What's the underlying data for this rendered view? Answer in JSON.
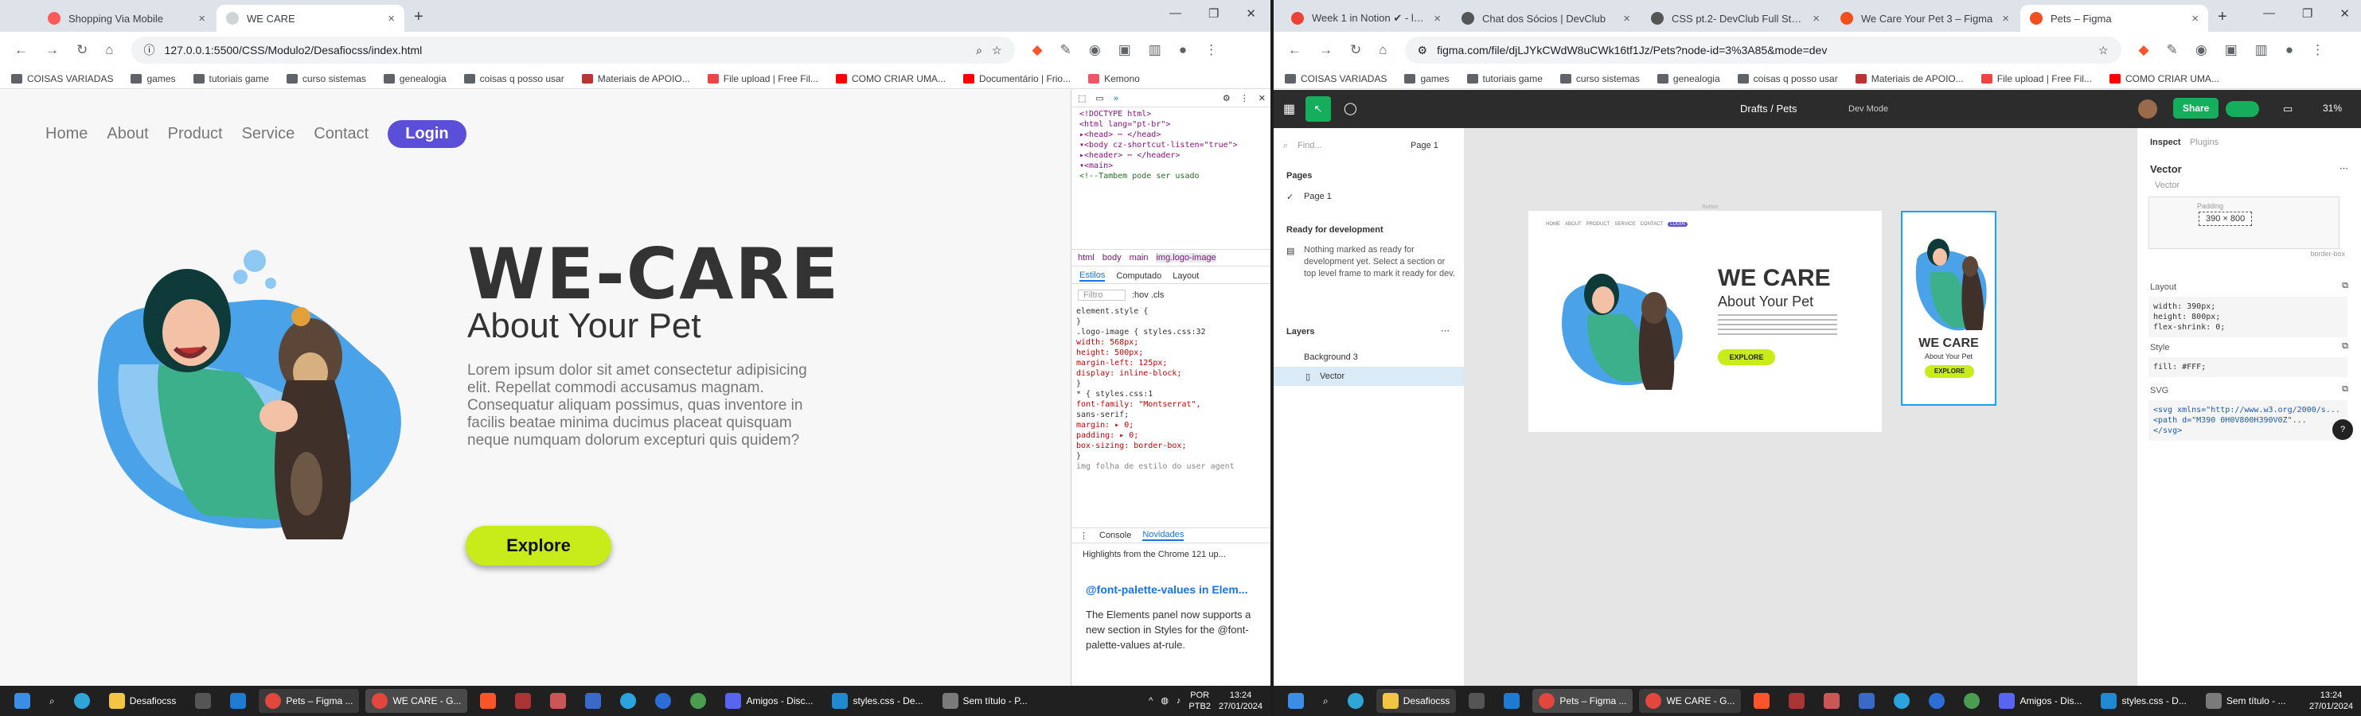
{
  "left": {
    "tabs": [
      {
        "title": "Shopping Via Mobile",
        "color": "#ff5a5a"
      },
      {
        "title": "WE CARE",
        "color": "#5f6368"
      }
    ],
    "url": "127.0.0.1:5500/CSS/Modulo2/Desafiocss/index.html",
    "bookmarks": [
      "COISAS VARIADAS",
      "games",
      "tutoriais game",
      "curso sistemas",
      "genealogia",
      "coisas q posso usar",
      "Materiais de APOIO...",
      "File upload | Free Fil...",
      "COMO CRIAR UMA...",
      "Documentário | Frio...",
      "Kemono"
    ],
    "page": {
      "nav": [
        "Home",
        "About",
        "Product",
        "Service",
        "Contact"
      ],
      "login": "Login",
      "title": "WE-CARE",
      "subtitle": "About Your Pet",
      "body": "Lorem ipsum dolor sit amet consectetur adipisicing elit. Repellat commodi accusamus magnam. Consequatur aliquam possimus, quas inventore in facilis beatae minima ducimus placeat quisquam neque numquam dolorum excepturi quis quidem?",
      "button": "Explore"
    },
    "devtools": {
      "html": [
        "<!DOCTYPE html>",
        "<html lang=\"pt-br\">",
        "▸<head> ⋯ </head>",
        "▾<body cz-shortcut-listen=\"true\">",
        "  ▸<header> ⋯ </header>",
        "  ▾<main>",
        "    <!--Tambem pode ser usado"
      ],
      "crumbs": [
        "html",
        "body",
        "main",
        "img.logo-image"
      ],
      "tabs": [
        "Estilos",
        "Computado",
        "Layout"
      ],
      "filter": "Filtro",
      "filter_opts": ":hov .cls",
      "css": [
        "element.style {",
        "}",
        ".logo-image {            styles.css:32",
        "  width: 568px;",
        "  height: 500px;",
        "  margin-left: 125px;",
        "  display: inline-block;",
        "}",
        "* {                       styles.css:1",
        "  font-family: \"Montserrat\",",
        "    sans-serif;",
        "  margin: ▸ 0;",
        "  padding: ▸ 0;",
        "  box-sizing: border-box;",
        "}",
        "img   folha de estilo do user agent"
      ],
      "drawer_tabs": [
        "Console",
        "Novidades"
      ],
      "drawer_text": "Highlights from the Chrome 121 up...",
      "drawer_heading": "@font-palette-values in Elem...",
      "drawer_body": "The Elements panel now supports a new section in Styles for the @font-palette-values at-rule."
    },
    "taskbar": [
      "Desafiocss",
      "Pets – Figma ...",
      "WE CARE - G...",
      "Amigos - Disc...",
      "styles.css - De...",
      "Sem título - P..."
    ],
    "tray": {
      "lang": "POR",
      "kb": "PTB2",
      "time": "13:24",
      "date": "27/01/2024"
    }
  },
  "right": {
    "tabs": [
      "Week 1 in Notion ✔ - lucia...",
      "Chat dos Sócios | DevClub",
      "CSS pt.2- DevClub Full Stack",
      "We Care Your Pet 3 – Figma",
      "Pets – Figma"
    ],
    "url": "figma.com/file/djLJYkCWdW8uCWk16tf1Jz/Pets?node-id=3%3A85&mode=dev",
    "bookmarks": [
      "COISAS VARIADAS",
      "games",
      "tutoriais game",
      "curso sistemas",
      "genealogia",
      "coisas q posso usar",
      "Materiais de APOIO...",
      "File upload | Free Fil...",
      "COMO CRIAR UMA..."
    ],
    "figma": {
      "breadcrumb": "Drafts / Pets",
      "mode": "Dev Mode",
      "share": "Share",
      "zoom": "31%",
      "find": "Find...",
      "page_select": "Page 1",
      "pages_title": "Pages",
      "page_item": "Page 1",
      "ready_title": "Ready for development",
      "ready_text": "Nothing marked as ready for development yet. Select a section or top level frame to mark it ready for dev.",
      "layers_title": "Layers",
      "layers": [
        "Background 3",
        "Vector"
      ],
      "inspect_tabs": [
        "Inspect",
        "Plugins"
      ],
      "node_title": "Vector",
      "node_sub": "Vector",
      "dims": "390 × 800",
      "padding_label": "Padding",
      "border_label": "border-box",
      "layout_title": "Layout",
      "layout_code": [
        "width: 390px;",
        "height: 800px;",
        "flex-shrink: 0;"
      ],
      "style_title": "Style",
      "style_code": "fill: #FFF;",
      "svg_title": "SVG",
      "svg_code": [
        "<svg xmlns=\"http://www.w3.org/2000/s...",
        "  <path d=\"M390 0H0V800H390V0Z\"...",
        "</svg>"
      ],
      "mini": {
        "nav": [
          "HOME",
          "ABOUT",
          "PRODUCT",
          "SERVICE",
          "CONTACT"
        ],
        "login": "LOGIN",
        "title": "WE CARE",
        "subtitle": "About Your Pet",
        "button": "EXPLORE",
        "label": "Button"
      },
      "mobile": {
        "title": "WE CARE",
        "subtitle": "About Your Pet",
        "button": "EXPLORE"
      }
    },
    "taskbar": [
      "Desafiocss",
      "Pets – Figma ...",
      "WE CARE - G...",
      "Amigos - Dis...",
      "styles.css - D...",
      "Sem título - ..."
    ],
    "tray": {
      "time": "13:24",
      "date": "27/01/2024"
    }
  }
}
